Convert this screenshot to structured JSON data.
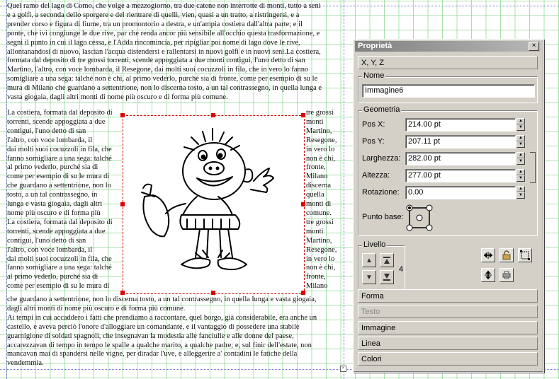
{
  "document": {
    "text_top": [
      "Quel ramo del lago di Como, che volge a mezzogiorno, tra due catene non interrotte di monti, tutto a seni",
      "e a golfi, a seconda dello sporgere e del rientrare di quelli, vien, quasi a un tratto, a ristringersi, e a",
      "prender corso e figura di fiume, tra un promontorio a destra, e un'ampia costiera dall'altra parte; e il",
      "ponte, che ivi congiunge le due rive, par che renda ancor più sensibile all'occhio questa trasformazione, e",
      "segni il punto in cui il lago cessa, e l'Adda rincomincia, per ripigliar poi nome di lago dove le rive,",
      "allontanandosi di nuovo, lascian l'acqua distendersi e rallentarsi in nuovi golfi e in nuovi seni.La costiera,",
      "formata dal deposito di tre grossi torrenti, scende appoggiata a due monti contigui, l'uno detto di san",
      "Martino, l'altro, con voce lombarda, il Resegone, dai molti suoi cocuzzoli in fila, che in vero lo fanno",
      "somigliare a una sega: talché non è chi, al primo vederlo, purché sia di fronte, come per esempio di su le",
      "mura di Milano che guardano a settentrione, non lo discerna tosto, a un tal contrassegno, in quella lunga e",
      "vasta giogaia, dagli altri monti di nome più oscuro e di forma più comune."
    ],
    "text_left": [
      "La costiera, formata dal deposito di",
      "torrenti, scende appoggiata a due",
      "contigui, l'uno detto di san",
      "l'altro, con voce lombarda, il",
      "dai molti suoi cocuzzoli in fila, che",
      "fanno somigliare a una sega: talché",
      "al primo vederlo, purché sia di",
      "come per esempio di su le mura di",
      "che guardano a settentrione, non lo",
      "tosto, a un tal contrassegno, in",
      "lunga e vasta giogaia, dagli altri",
      "nome più oscuro e di forma più",
      "La costiera, formata dal deposito di",
      "torrenti, scende appoggiata a due",
      "contigui, l'uno detto di san",
      "l'altro, con voce lombarda, il",
      "dai molti suoi cocuzzoli in fila, che",
      "fanno somigliare a una sega: talché",
      "al primo vederlo, purché sia di",
      "come per esempio di su le mura di"
    ],
    "text_right": [
      "tre grossi",
      "monti",
      "Martino,",
      "Resegone,",
      "in vero lo",
      "non è chi,",
      "fronte,",
      "Milano",
      "discerna",
      "quella",
      "monti di",
      "comune.",
      "tre grossi",
      "monti",
      "Martino,",
      "Resegone,",
      "in vero lo",
      "non è chi,",
      "fronte,",
      "Milano"
    ],
    "text_bottom": [
      "che guardano a settentrione, non lo discerna tosto, a un tal contrassegno, in quella lunga e vasta giogaia,",
      "dagli altri monti di nome più oscuro e di forma più comune.",
      "Ai tempi in cui accaddero i fatti che prendiamo a raccontare, quel borgo, già considerabile, era anche un",
      "castello, e aveva perciò l'onore d'alloggiare un comandante, e il vantaggio di possedere una stabile",
      "guarnigione di soldati spagnoli, che insegnavan la modestia alle fanciulle e alle donne del paese,",
      "accarezzavan di tempo in tempo le spalle a qualche marito, a qualche padre; e, sul finir dell'estate, non",
      "mancavan mai di spandersi nelle vigne, per diradar l'uve, e alleggerire a' contadini le fatiche della",
      "vendemmia."
    ]
  },
  "palette": {
    "title": "Proprietà",
    "close": "×",
    "section_xyz": "X, Y, Z",
    "nome": {
      "legend": "Nome",
      "value": "Immagine6"
    },
    "geometria": {
      "legend": "Geometria",
      "pos_x_label": "Pos X:",
      "pos_x_value": "214.00 pt",
      "pos_y_label": "Pos Y:",
      "pos_y_value": "207.11 pt",
      "larghezza_label": "Larghezza:",
      "larghezza_value": "282.00 pt",
      "altezza_label": "Altezza:",
      "altezza_value": "277.00 pt",
      "rotazione_label": "Rotazione:",
      "rotazione_value": "0.00",
      "punto_base_label": "Punto base:"
    },
    "livello": {
      "legend": "Livello",
      "value": "4"
    },
    "tabs": {
      "forma": "Forma",
      "testo": "Testo",
      "immagine": "Immagine",
      "linea": "Linea",
      "colori": "Colori"
    }
  },
  "icons": {
    "up_arrow": "▲",
    "down_arrow": "▼",
    "small_up": "▲",
    "small_down": "▼"
  },
  "colors": {
    "grid": "#8cd78c",
    "guides": "#6b6bd8",
    "selection": "#e00000",
    "palette_bg": "#d4d0c8",
    "title_bar": "#808080"
  }
}
